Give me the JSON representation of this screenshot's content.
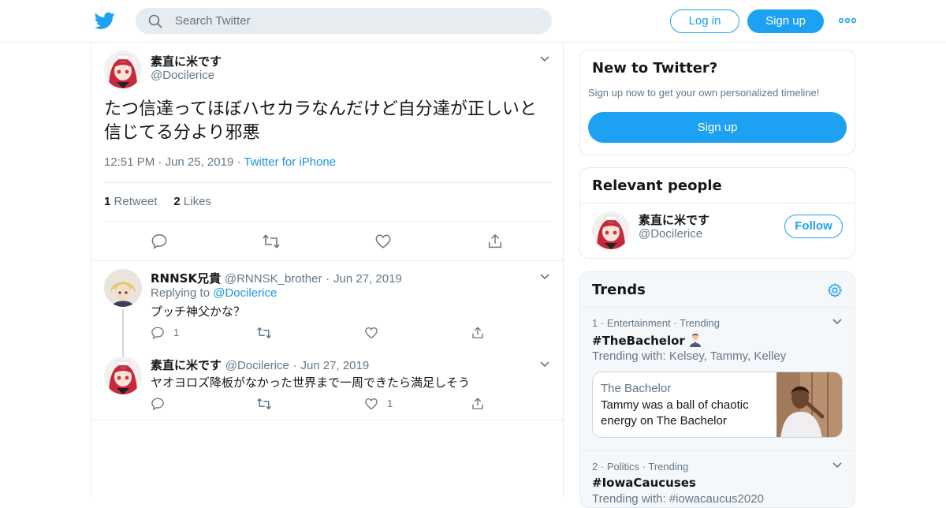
{
  "header": {
    "search_placeholder": "Search Twitter",
    "login_label": "Log in",
    "signup_label": "Sign up"
  },
  "tweet": {
    "author_name": "素直に米です",
    "author_handle": "@Docilerice",
    "text": "たつ信達ってほぼハセカラなんだけど自分達が正しいと信じてる分より邪悪",
    "time": "12:51 PM",
    "sep1": "·",
    "date": "Jun 25, 2019",
    "sep2": "·",
    "source": "Twitter for iPhone",
    "retweets_count": "1",
    "retweets_label": "Retweet",
    "likes_count": "2",
    "likes_label": "Likes"
  },
  "replies": [
    {
      "name": "RNNSK兄貴",
      "handle": "@RNNSK_brother",
      "sep": "·",
      "date": "Jun 27, 2019",
      "replying_label": "Replying to",
      "replying_handle": "@Docilerice",
      "text": "プッチ神父かな？",
      "reply_count": "1",
      "like_count": ""
    },
    {
      "name": "素直に米です",
      "handle": "@Docilerice",
      "sep": "·",
      "date": "Jun 27, 2019",
      "text": "ヤオヨロズ降板がなかった世界まで一周できたら満足しそう",
      "reply_count": "",
      "like_count": "1"
    }
  ],
  "sidebar": {
    "new_title": "New to Twitter?",
    "new_subtitle": "Sign up now to get your own personalized timeline!",
    "new_signup": "Sign up",
    "relevant_title": "Relevant people",
    "person_name": "素直に米です",
    "person_handle": "@Docilerice",
    "follow_label": "Follow",
    "trends_title": "Trends",
    "trends": [
      {
        "rank": "1",
        "category": "Entertainment",
        "status": "Trending",
        "tag": "#TheBachelor",
        "with": "Trending with: Kelsey, Tammy, Kelley",
        "news_source": "The Bachelor",
        "news_text": "Tammy was a ball of chaotic energy on The Bachelor"
      },
      {
        "rank": "2",
        "category": "Politics",
        "status": "Trending",
        "tag": "#IowaCaucuses",
        "with": "Trending with: #iowacaucus2020"
      }
    ],
    "dot": "·"
  },
  "colors": {
    "brand": "#1da1f2",
    "link": "#1b95e0",
    "muted": "#657786",
    "border": "#e6ecf0"
  },
  "icons": [
    "twitter-bird-icon",
    "search-icon",
    "more-icon",
    "chevron-down-icon",
    "reply-icon",
    "retweet-icon",
    "like-icon",
    "share-icon",
    "gear-icon",
    "man-emoji-icon"
  ]
}
